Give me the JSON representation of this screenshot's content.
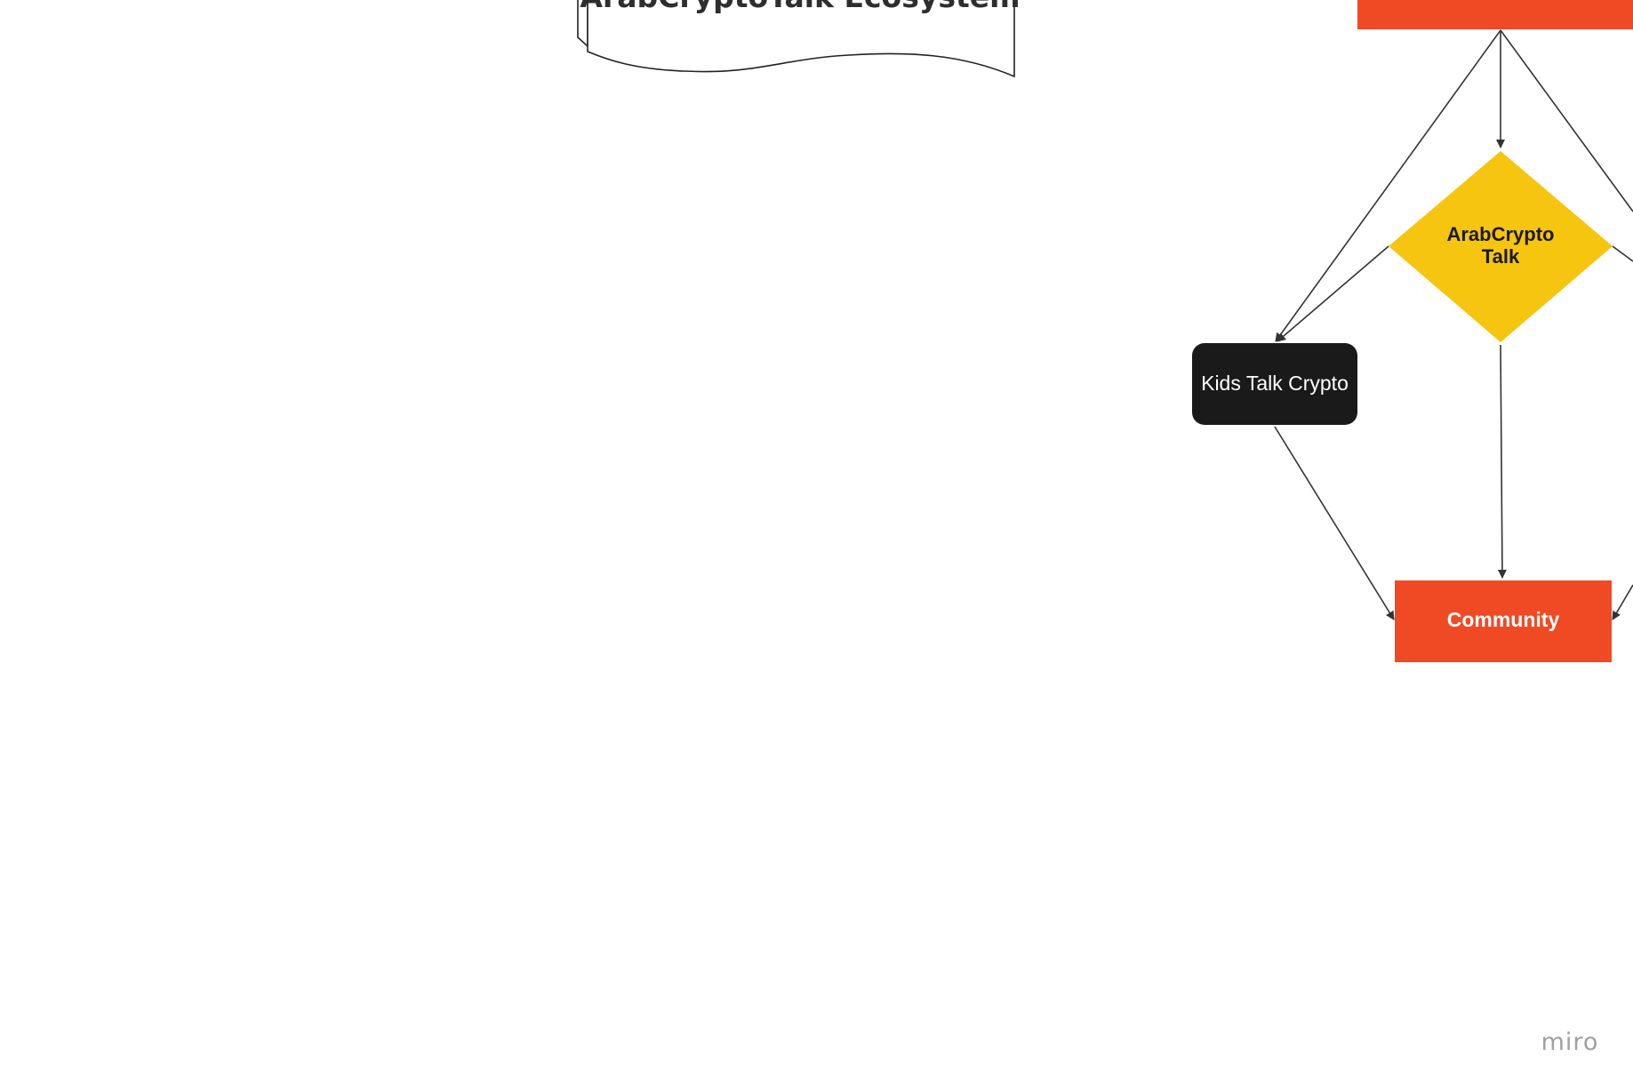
{
  "diagram": {
    "title_document": {
      "title": "ArabCryptoTalk Ecosystem"
    },
    "nodes": {
      "top": {
        "label": "",
        "color": "#f04a25"
      },
      "diamond": {
        "label_line1": "ArabCrypto",
        "label_line2": "Talk",
        "color": "#f6c510"
      },
      "kids": {
        "label": "Kids Talk Crypto",
        "color": "#1a1a1a"
      },
      "community": {
        "label": "Community",
        "color": "#f04a25"
      }
    },
    "edges": [
      {
        "from": "top",
        "to": "diamond"
      },
      {
        "from": "top",
        "to": "kids"
      },
      {
        "from": "top",
        "to": "offscreen-right"
      },
      {
        "from": "diamond",
        "to": "kids"
      },
      {
        "from": "diamond",
        "to": "community"
      },
      {
        "from": "diamond",
        "to": "offscreen-right"
      },
      {
        "from": "kids",
        "to": "community"
      },
      {
        "from": "offscreen-right",
        "to": "community"
      }
    ]
  },
  "branding": {
    "watermark": "miro"
  }
}
